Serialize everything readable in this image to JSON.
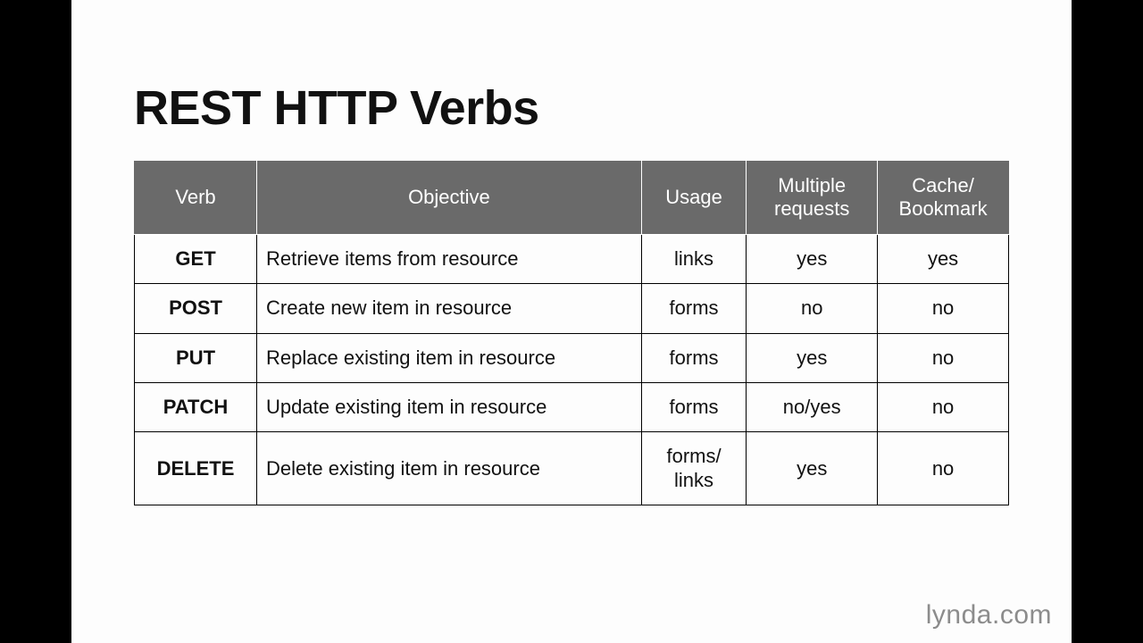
{
  "title": "REST HTTP Verbs",
  "headers": {
    "verb": "Verb",
    "objective": "Objective",
    "usage": "Usage",
    "multiple": "Multiple requests",
    "cache": "Cache/ Bookmark"
  },
  "rows": [
    {
      "verb": "GET",
      "objective": "Retrieve items from resource",
      "usage": "links",
      "multiple": "yes",
      "cache": "yes"
    },
    {
      "verb": "POST",
      "objective": "Create new item in resource",
      "usage": "forms",
      "multiple": "no",
      "cache": "no"
    },
    {
      "verb": "PUT",
      "objective": "Replace existing item in resource",
      "usage": "forms",
      "multiple": "yes",
      "cache": "no"
    },
    {
      "verb": "PATCH",
      "objective": "Update existing item in resource",
      "usage": "forms",
      "multiple": "no/yes",
      "cache": "no"
    },
    {
      "verb": "DELETE",
      "objective": "Delete existing item in resource",
      "usage": "forms/ links",
      "multiple": "yes",
      "cache": "no"
    }
  ],
  "attribution": {
    "brand": "lynda",
    "tld": ".com"
  }
}
